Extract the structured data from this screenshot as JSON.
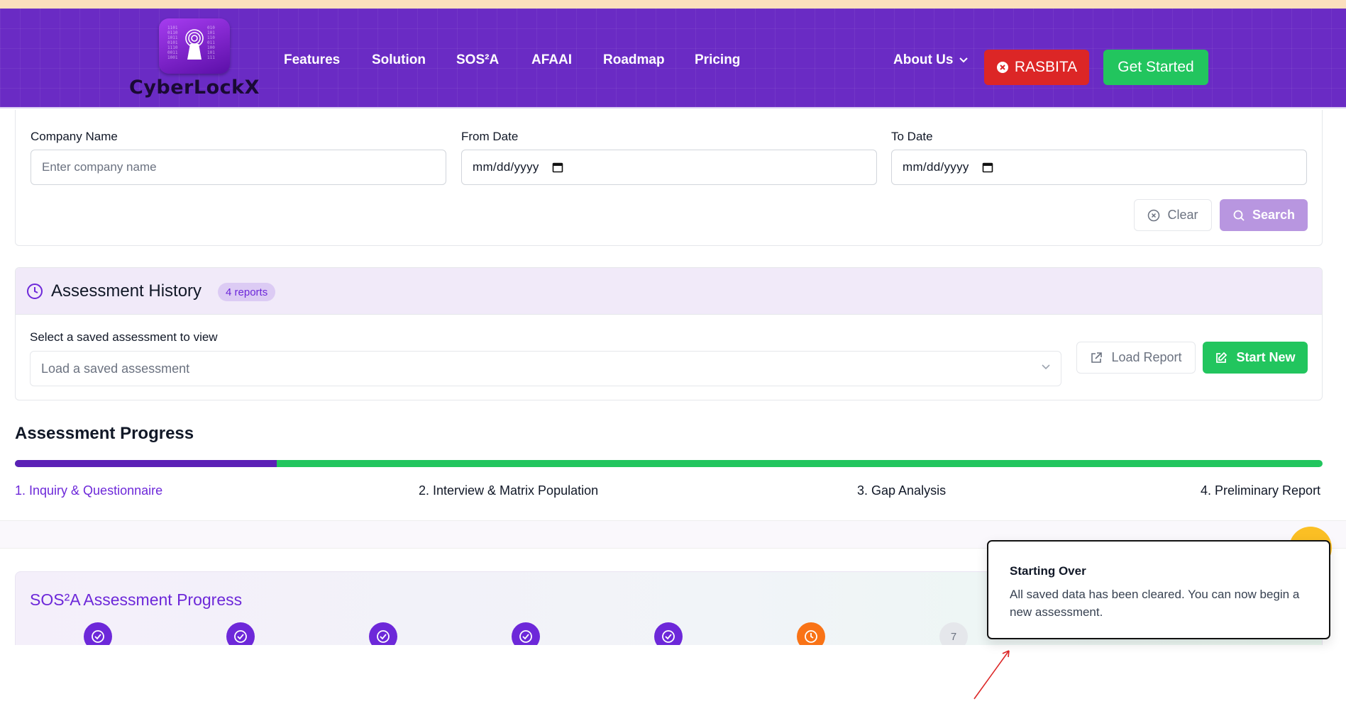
{
  "brand": {
    "name": "CyberLockX"
  },
  "nav": {
    "links": [
      "Features",
      "Solution",
      "SOS²A",
      "AFAAI",
      "Roadmap",
      "Pricing"
    ],
    "about": "About Us",
    "rasbita": "RASBITA",
    "get_started": "Get Started"
  },
  "search": {
    "company_label": "Company Name",
    "company_placeholder": "Enter company name",
    "from_label": "From Date",
    "from_value": "mm/dd/yyyy",
    "to_label": "To Date",
    "to_value": "mm/dd/yyyy",
    "clear": "Clear",
    "search": "Search"
  },
  "history": {
    "title": "Assessment History",
    "badge": "4 reports",
    "select_label": "Select a saved assessment to view",
    "select_placeholder": "Load a saved assessment",
    "load": "Load Report",
    "start_new": "Start New"
  },
  "progress": {
    "title": "Assessment Progress",
    "fill_fraction": 0.2,
    "steps": [
      "1. Inquiry & Questionnaire",
      "2. Interview & Matrix Population",
      "3. Gap Analysis",
      "4. Preliminary Report"
    ],
    "active_step": 1
  },
  "sos": {
    "title": "SOS²A Assessment Progress",
    "pending_step_number": "7"
  },
  "toast": {
    "title": "Starting Over",
    "message": "All saved data has been cleared. You can now begin a new assessment."
  },
  "colors": {
    "nav_bg": "#6a2bc4",
    "accent_purple": "#6d28d9",
    "green": "#22c55e",
    "red": "#dc2626",
    "orange": "#f97316"
  }
}
